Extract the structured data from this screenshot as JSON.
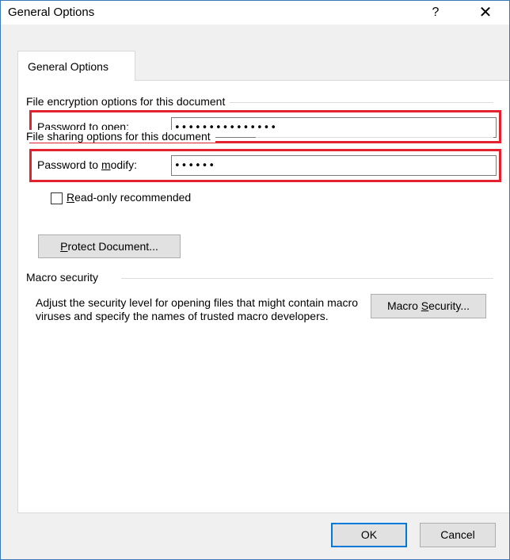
{
  "dialog": {
    "title": "General Options",
    "help_glyph": "?",
    "close_glyph": "✕"
  },
  "tab": {
    "label": "General Options"
  },
  "encryption": {
    "section_label": "File encryption options for this document",
    "password_open_label_pre": "Password to ",
    "password_open_label_accel": "o",
    "password_open_label_post": "pen:",
    "password_open_value": "•••••••••••••••"
  },
  "sharing": {
    "section_label": "File sharing options for this document",
    "password_modify_label_pre": "Password to ",
    "password_modify_label_accel": "m",
    "password_modify_label_post": "odify:",
    "password_modify_value": "••••••",
    "readonly_accel": "R",
    "readonly_label_post": "ead-only recommended",
    "readonly_checked": false,
    "protect_accel": "P",
    "protect_label_post": "rotect Document..."
  },
  "macro": {
    "section_label": "Macro security",
    "description": "Adjust the security level for opening files that might contain macro viruses and specify the names of trusted macro developers.",
    "button_pre": "Macro ",
    "button_accel": "S",
    "button_post": "ecurity..."
  },
  "footer": {
    "ok_label": "OK",
    "cancel_label": "Cancel"
  },
  "colors": {
    "highlight": "#e3212f",
    "default_button_border": "#0078d7"
  }
}
